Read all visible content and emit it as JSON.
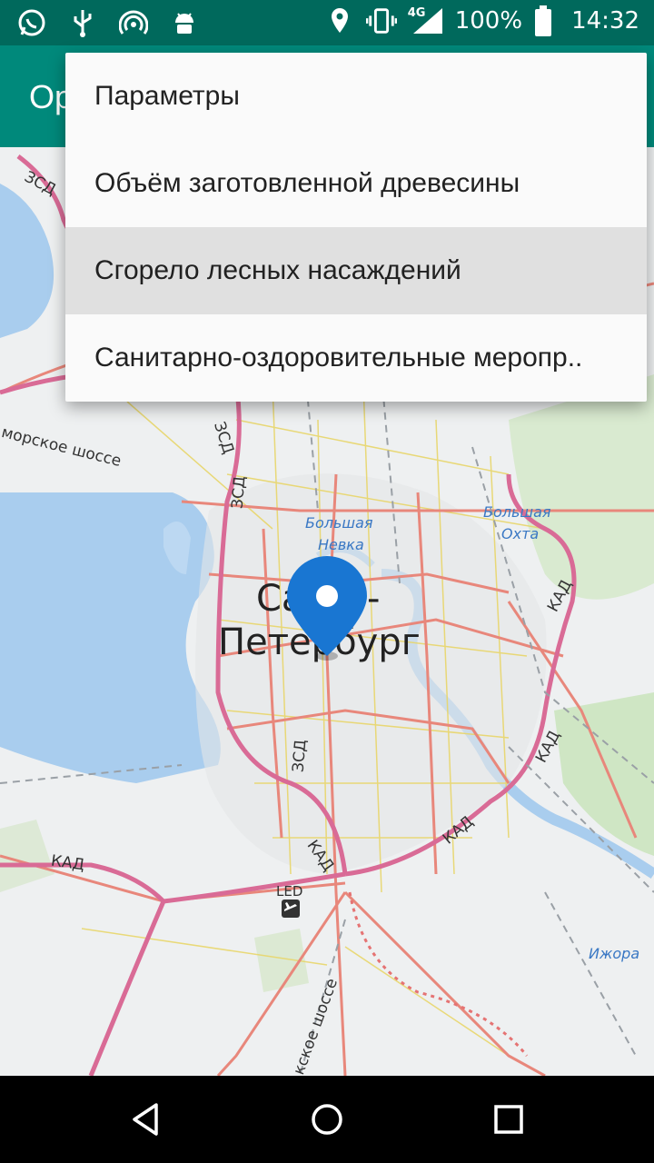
{
  "status_bar": {
    "time": "14:32",
    "battery_percent": "100%",
    "network": "4G",
    "left_icons": [
      "whatsapp-icon",
      "usb-icon",
      "hotspot-icon",
      "android-debug-icon"
    ],
    "right_icons": [
      "location-icon",
      "vibrate-icon",
      "signal-icon",
      "battery-icon"
    ]
  },
  "app_bar": {
    "title_visible_part": "Ор",
    "color": "#00897b"
  },
  "menu": {
    "items": [
      {
        "label": "Параметры"
      },
      {
        "label": "Объём заготовленной древесины"
      },
      {
        "label": "Сгорело лесных насаждений",
        "selected": true
      },
      {
        "label": "Санитарно-оздоровительные меропр.."
      }
    ]
  },
  "map": {
    "city_line1_left": "Са",
    "city_line1_right": "-",
    "city_line2": "Петербург",
    "road_zsd": "ЗСД",
    "road_kad": "КАД",
    "primorskoe": "морское шоссе",
    "bolshaya_nevka_1": "Большая",
    "bolshaya_nevka_2": "Невка",
    "bolshaya_okhta_1": "Большая",
    "bolshaya_okhta_2": "Охта",
    "izhora": "Ижора",
    "airport_code": "LED",
    "kievskoe": "кское шоссе",
    "marker_color": "#1976d2"
  },
  "nav_bar": {
    "back": "back-icon",
    "home": "home-icon",
    "recents": "recents-icon"
  }
}
